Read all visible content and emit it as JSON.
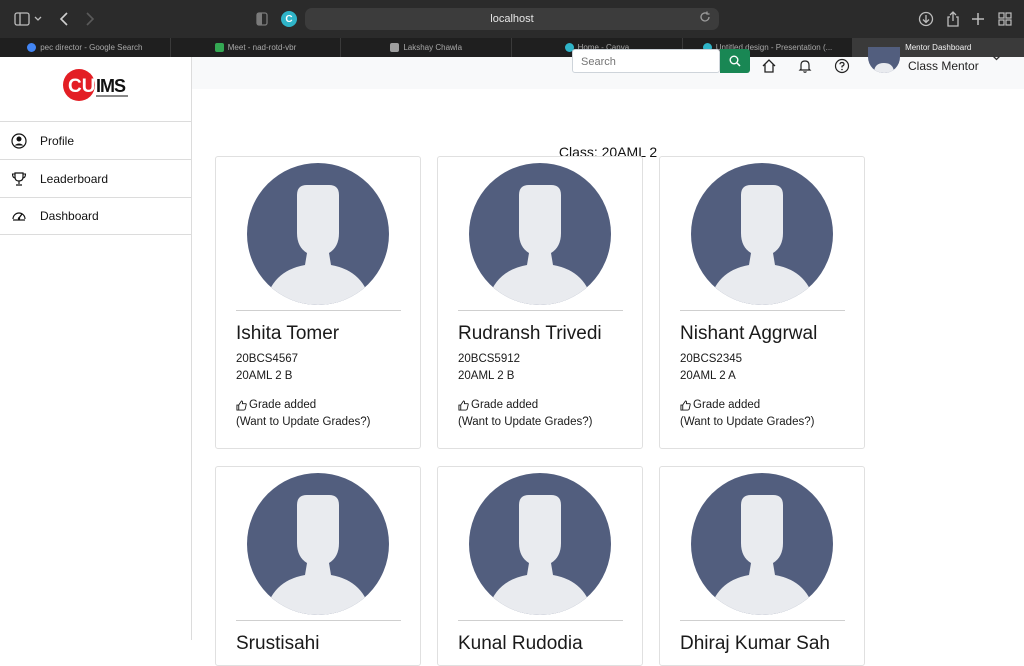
{
  "browser": {
    "url": "localhost",
    "favicon_letter": "C",
    "tabs": [
      {
        "label": "pec director - Google Search",
        "color": "#4285f4"
      },
      {
        "label": "Meet - nad-rotd-vbr",
        "color": "#34a853"
      },
      {
        "label": "Lakshay Chawla",
        "color": "#9e9e9e"
      },
      {
        "label": "Home - Canva",
        "color": "#2fb4c8"
      },
      {
        "label": "Untitled design - Presentation (...",
        "color": "#2fb4c8"
      },
      {
        "label": "Mentor Dashboard",
        "color": "",
        "active": true
      }
    ]
  },
  "logo": {
    "text": "CUIMS"
  },
  "sidebar": {
    "items": [
      {
        "label": "Profile",
        "icon": "user-circle-icon"
      },
      {
        "label": "Leaderboard",
        "icon": "trophy-icon"
      },
      {
        "label": "Dashboard",
        "icon": "speedometer-icon"
      }
    ]
  },
  "header": {
    "search_placeholder": "Search",
    "user_role": "Class Mentor"
  },
  "main": {
    "class_title": "Class: 20AML 2",
    "students": [
      {
        "name": "Ishita Tomer",
        "uid": "20BCS4567",
        "section": "20AML 2 B",
        "status": "Grade added",
        "update": "(Want to Update Grades?)"
      },
      {
        "name": "Rudransh Trivedi",
        "uid": "20BCS5912",
        "section": "20AML 2 B",
        "status": "Grade added",
        "update": "(Want to Update Grades?)"
      },
      {
        "name": "Nishant Aggrwal",
        "uid": "20BCS2345",
        "section": "20AML 2 A",
        "status": "Grade added",
        "update": "(Want to Update Grades?)"
      },
      {
        "name": "Srustisahi",
        "uid": "",
        "section": "",
        "status": "",
        "update": ""
      },
      {
        "name": "Kunal Rudodia",
        "uid": "",
        "section": "",
        "status": "",
        "update": ""
      },
      {
        "name": "Dhiraj Kumar Sah",
        "uid": "",
        "section": "",
        "status": "",
        "update": ""
      }
    ]
  },
  "colors": {
    "avatar_bg": "#525e7e",
    "avatar_fg": "#e9ebef",
    "accent_green": "#198754"
  }
}
